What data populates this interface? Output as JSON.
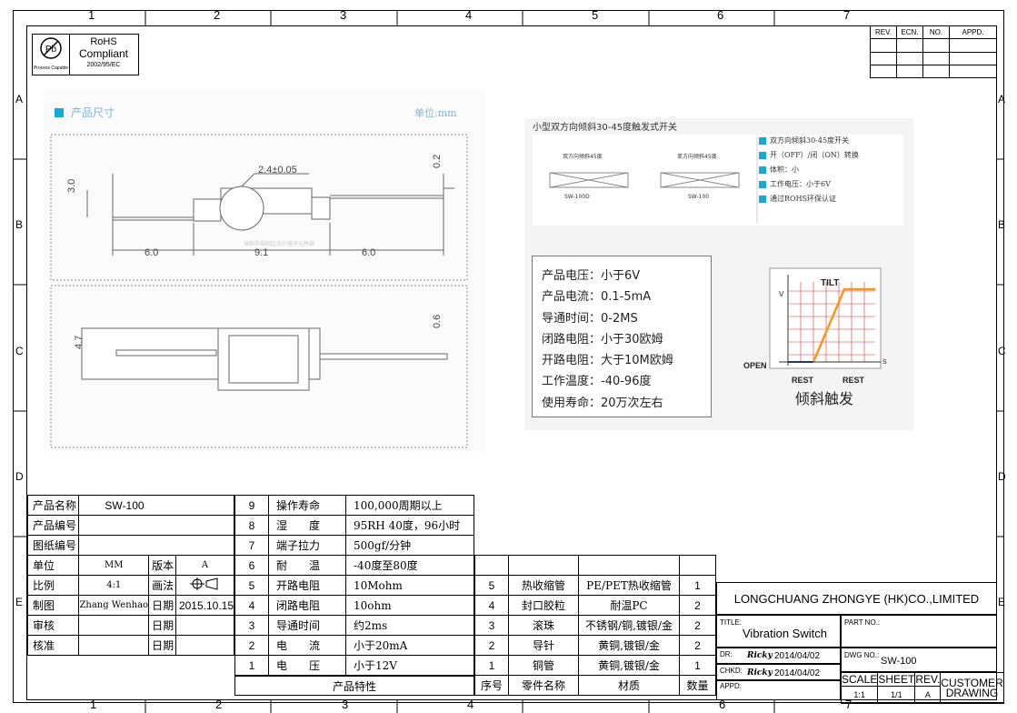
{
  "zones": {
    "top": [
      "1",
      "2",
      "3",
      "4",
      "5",
      "6",
      "7"
    ],
    "bottom": [
      "1",
      "2",
      "3",
      "4",
      "5",
      "6",
      "7"
    ],
    "left": [
      "A",
      "B",
      "C",
      "D",
      "E"
    ],
    "right": [
      "A",
      "B",
      "C",
      "D",
      "E"
    ]
  },
  "rohs": {
    "line1": "RoHS",
    "line2": "Compliant",
    "line3": "2002/95/EC",
    "pb_symbol": "Pb",
    "process_capable": "Process Capable"
  },
  "revision": {
    "headers": [
      "REV.",
      "ECN.",
      "NO.",
      "APPD."
    ]
  },
  "drawing": {
    "section_title": "产品尺寸",
    "unit_label": "单位:mm",
    "dims": {
      "diameter": "2.4±0.05",
      "height_top": "3.0",
      "pin_top": "0.2",
      "left_len": "6.0",
      "body_len": "9.1",
      "right_len": "6.0",
      "height_bottom": "4.7",
      "pin_bottom": "0.6"
    },
    "watermark": "深圳市福田区东兴电子元件部"
  },
  "photo": {
    "title": "小型双方向倾斜30-45度触发式开关",
    "sw1_caption": "双方向倾斜45度",
    "sw1_model": "SW-100D",
    "sw2_caption": "单方向倾斜45度",
    "sw2_model": "SW-100",
    "features": [
      "双方向倾斜30-45度开关",
      "开（OFF）/闭（ON）转换",
      "体积：小",
      "工作电压：小于6V",
      "通过ROHS环保认证"
    ],
    "specs": [
      "产品电压：小于6V",
      "产品电流：0.1-5mA",
      "导通时间：0-2MS",
      "闭路电阻：小于30欧姆",
      "开路电阻：大于10M欧姆",
      "工作温度：-40-96度",
      "使用寿命：20万次左右"
    ],
    "graph": {
      "tilt": "TILT",
      "v_axis": "V",
      "s_axis": "S",
      "open": "OPEN",
      "rest_left": "REST",
      "rest_right": "REST",
      "caption": "倾斜触发"
    }
  },
  "info_table": {
    "product_name_label": "产品名称",
    "product_name": "SW-100",
    "product_no_label": "产品编号",
    "drawing_no_label": "图纸编号",
    "unit_label": "单位",
    "unit": "MM",
    "version_label": "版本",
    "version": "A",
    "scale_label": "比例",
    "scale": "4:1",
    "projection_label": "画法",
    "made_label": "制图",
    "made_by": "Zhang Wenhao",
    "date_label": "日期",
    "made_date": "2015.10.15",
    "review_label": "审核",
    "approve_label": "核准"
  },
  "props": [
    {
      "no": "9",
      "name": "操作寿命",
      "value": "100,000周期以上"
    },
    {
      "no": "8",
      "name": "湿　　度",
      "value": "95RH 40度，96小时"
    },
    {
      "no": "7",
      "name": "端子拉力",
      "value": "500gf/分钟"
    },
    {
      "no": "6",
      "name": "耐　　温",
      "value": "-40度至80度"
    },
    {
      "no": "5",
      "name": "开路电阻",
      "value": "10Mohm"
    },
    {
      "no": "4",
      "name": "闭路电阻",
      "value": "10ohm"
    },
    {
      "no": "3",
      "name": "导通时间",
      "value": "约2ms"
    },
    {
      "no": "2",
      "name": "电　　流",
      "value": "小于20mA"
    },
    {
      "no": "1",
      "name": "电　　压",
      "value": "小于12V"
    }
  ],
  "props_footer": "产品特性",
  "parts": [
    {
      "no": "5",
      "name": "热收缩管",
      "material": "PE/PET热收缩管",
      "qty": "1"
    },
    {
      "no": "4",
      "name": "封口胶粒",
      "material": "耐温PC",
      "qty": "2"
    },
    {
      "no": "3",
      "name": "滚珠",
      "material": "不锈钢/铜,镀银/金",
      "qty": "2"
    },
    {
      "no": "2",
      "name": "导针",
      "material": "黄铜,镀银/金",
      "qty": "2"
    },
    {
      "no": "1",
      "name": "铜管",
      "material": "黄铜,镀银/金",
      "qty": "1"
    }
  ],
  "parts_footer": {
    "no": "序号",
    "name": "零件名称",
    "material": "材质",
    "qty": "数量"
  },
  "title_block": {
    "company": "LONGCHUANG ZHONGYE (HK)CO.,LIMITED",
    "title_label": "TITLE:",
    "title": "Vibration Switch",
    "part_no_label": "PART NO.:",
    "dr_label": "DR:",
    "dr_sign": "Ricky",
    "dr_date": "2014/04/02",
    "dwg_no_label": "DWG NO.:",
    "dwg_no": "SW-100",
    "chkd_label": "CHKD:",
    "chkd_sign": "Ricky",
    "chkd_date": "2014/04/02",
    "appd_label": "APPD:",
    "scale_label": "SCALE",
    "scale": "1:1",
    "sheet_label": "SHEET",
    "sheet": "1/1",
    "rev_label": "REV.",
    "rev": "A",
    "customer_drawing_1": "CUSTOMER",
    "customer_drawing_2": "DRAWING"
  }
}
